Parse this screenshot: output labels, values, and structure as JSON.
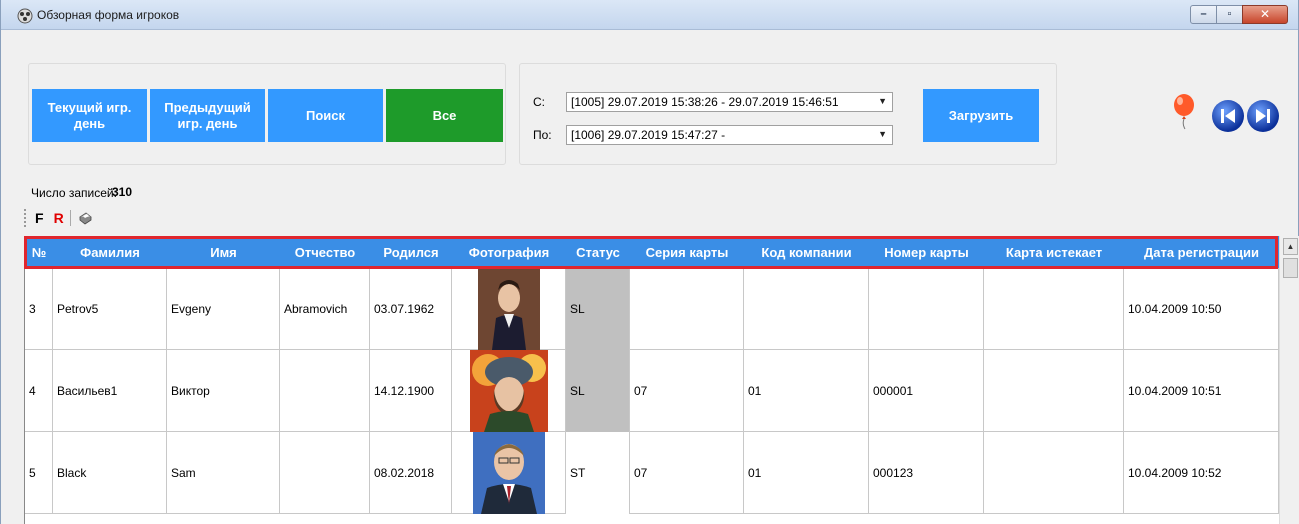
{
  "window": {
    "title": "Обзорная форма игроков",
    "icons": {
      "app": "app-icon",
      "minimize": "minimize-icon",
      "maximize": "maximize-icon",
      "close": "close-icon"
    }
  },
  "buttons": {
    "current_day": "Текущий игр. день",
    "previous_day": "Предыдущий игр. день",
    "search": "Поиск",
    "all": "Все",
    "load": "Загрузить"
  },
  "range": {
    "from_label": "С:",
    "from_value": "[1005] 29.07.2019 15:38:26 - 29.07.2019 15:46:51",
    "to_label": "По:",
    "to_value": "[1006] 29.07.2019 15:47:27 -"
  },
  "records": {
    "label": "Число записей:",
    "count": "310"
  },
  "toolbar": {
    "filter_label": "F",
    "reset_label": "R",
    "print_icon": "print-icon"
  },
  "grid": {
    "columns": [
      "№",
      "Фамилия",
      "Имя",
      "Отчество",
      "Родился",
      "Фотография",
      "Статус",
      "Серия карты",
      "Код компании",
      "Номер карты",
      "Карта истекает",
      "Дата регистрации"
    ],
    "rows": [
      {
        "num": "3",
        "surname": "Petrov5",
        "name": "Evgeny",
        "patronymic": "Abramovich",
        "born": "03.07.1962",
        "photo": "portrait-napoleon",
        "status": "SL",
        "card_series": "",
        "company_code": "",
        "card_number": "",
        "card_expires": "",
        "registered": "10.04.2009 10:50"
      },
      {
        "num": "4",
        "surname": "Васильев1",
        "name": "Виктор",
        "patronymic": "",
        "born": "14.12.1900",
        "photo": "portrait-fur-hat",
        "status": "SL",
        "card_series": "07",
        "company_code": "01",
        "card_number": "000001",
        "card_expires": "",
        "registered": "10.04.2009 10:51"
      },
      {
        "num": "5",
        "surname": "Black",
        "name": "Sam",
        "patronymic": "",
        "born": "08.02.2018",
        "photo": "portrait-suit",
        "status": "ST",
        "card_series": "07",
        "company_code": "01",
        "card_number": "000123",
        "card_expires": "",
        "registered": "10.04.2009 10:52"
      }
    ]
  },
  "colors": {
    "button_blue": "#3399ff",
    "button_green": "#1e9b2a",
    "header_blue": "#3a8ee6",
    "highlight_red": "#e0262e",
    "status_gray": "#c0c0c0"
  }
}
